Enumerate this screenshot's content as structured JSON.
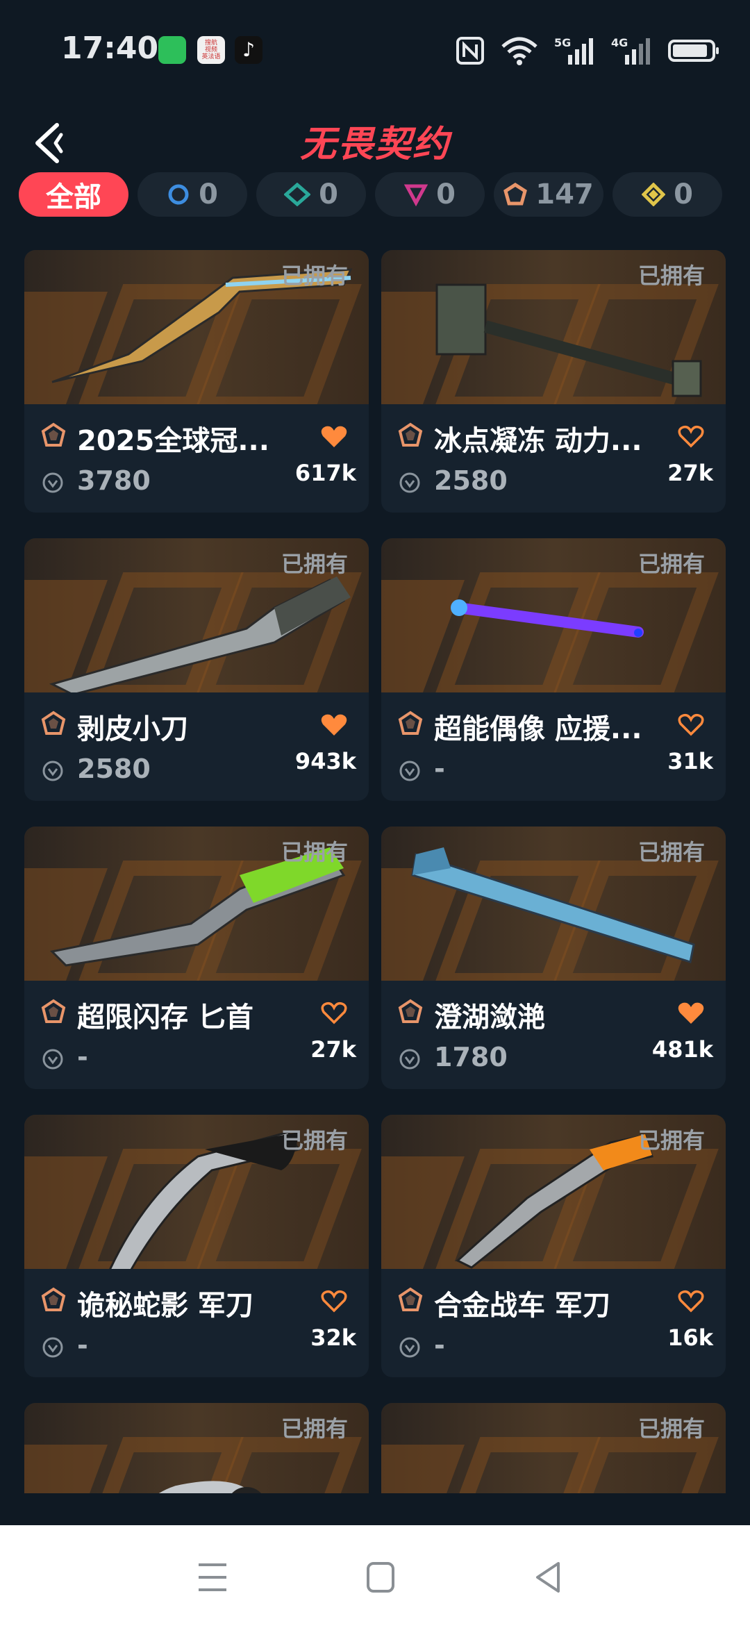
{
  "status": {
    "time": "17:40",
    "signal_5g": "5G",
    "signal_4g": "4G",
    "notif_app2_text": "搜航\n视频\n英法语"
  },
  "header": {
    "title": "无畏契约"
  },
  "filters": [
    {
      "label": "全部",
      "icon": ""
    },
    {
      "label": "0",
      "icon": "circle-tier-icon"
    },
    {
      "label": "0",
      "icon": "diamond-tier-icon"
    },
    {
      "label": "0",
      "icon": "triangle-tier-icon"
    },
    {
      "label": "147",
      "icon": "pentagon-tier-icon"
    },
    {
      "label": "0",
      "icon": "rhombus-tier-icon"
    }
  ],
  "cards": [
    {
      "name": "2025全球冠...",
      "price": "3780",
      "likes": "617k",
      "owned": "已拥有",
      "liked": true
    },
    {
      "name": "冰点凝冻 动力...",
      "price": "2580",
      "likes": "27k",
      "owned": "已拥有",
      "liked": false
    },
    {
      "name": "剥皮小刀",
      "price": "2580",
      "likes": "943k",
      "owned": "已拥有",
      "liked": true
    },
    {
      "name": "超能偶像 应援...",
      "price": "-",
      "likes": "31k",
      "owned": "已拥有",
      "liked": false
    },
    {
      "name": "超限闪存 匕首",
      "price": "-",
      "likes": "27k",
      "owned": "已拥有",
      "liked": false
    },
    {
      "name": "澄湖潋滟",
      "price": "1780",
      "likes": "481k",
      "owned": "已拥有",
      "liked": true
    },
    {
      "name": "诡秘蛇影 军刀",
      "price": "-",
      "likes": "32k",
      "owned": "已拥有",
      "liked": false
    },
    {
      "name": "合金战车 军刀",
      "price": "-",
      "likes": "16k",
      "owned": "已拥有",
      "liked": false
    },
    {
      "name": "",
      "price": "",
      "likes": "",
      "owned": "已拥有",
      "liked": false
    },
    {
      "name": "",
      "price": "",
      "likes": "",
      "owned": "已拥有",
      "liked": false
    }
  ],
  "colors": {
    "accent": "#ff4655",
    "heart": "#ff8a3d",
    "tier": "#e8956a",
    "card_bg": "#16222e",
    "page_bg": "#0f1923"
  }
}
